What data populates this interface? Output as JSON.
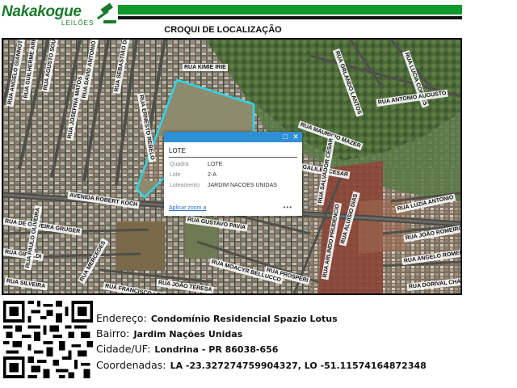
{
  "header": {
    "brand_name": "Nakakogue",
    "brand_sub": "LEILÕES",
    "title": "CROQUI DE LOCALIZAÇÃO"
  },
  "colors": {
    "brand_green": "#0e9a2c",
    "parcel_outline": "#2fd4e8",
    "popup_header": "#2f8fd3",
    "link_blue": "#2a6fc2"
  },
  "map": {
    "street_labels": [
      "RUA ANGELO GIANNOTTI",
      "RUA GUILHERME ARBELLI",
      "RUA AGUSTO SOUZA",
      "RUA JOSEFINA MATOS",
      "RUA DAVID ANTONIO PEDRO",
      "RUA SEBASTIÃO DE MELLO",
      "RUA ERNESTO REBELO",
      "RUA KIMIE IRIE",
      "RUA ORLANDO LANTOS",
      "RUA LUCIA CORTES",
      "RUA ANTONIO AUGUSTO",
      "RUA MAURÍCIO MAZER",
      "RUA GALILEU CESAR",
      "RUA SALVADOR CESAR",
      "AVENIDA ROBERT KOCH",
      "RUA GUSTAVO PAVIA",
      "RUA ARLINDO PRUDENCIO",
      "RUA DE OLIVEIRA GRUGER",
      "RUA GIRALDI",
      "RUA SILVEIRA",
      "RUA JOÃO TERESA",
      "RUA PAULO OLIVEIRA",
      "RUA MERCEDES",
      "RUA MOACYR BELLUCCO",
      "RUA PROSPERI",
      "RUA ALUÍSIO DIAS",
      "RUA LUZIA ANTONIO",
      "RUA JOÃO ROMEIRO",
      "RUA ANGELO ROMEIRO",
      "RUA DORIVAL CHAVES",
      "RUA FRANCISCO LEITE"
    ]
  },
  "popup": {
    "title": "LOTE",
    "rows": [
      {
        "key": "Quadra",
        "value": "LOTE"
      },
      {
        "key": "Lote",
        "value": "2-A"
      },
      {
        "key": "Loteamento",
        "value": "JARDIM NACOES UNIDAS"
      }
    ],
    "zoom_link": "Aplicar zoom a",
    "more": "•••",
    "maximize_icon": "□",
    "close_icon": "✕"
  },
  "info": {
    "endereco_label": "Endereço:",
    "endereco_value": "Condomínio Residencial Spazio Lotus",
    "bairro_label": "Bairro:",
    "bairro_value": "Jardim Nações Unidas",
    "cidade_label": "Cidade/UF:",
    "cidade_value": "Londrina - PR 86038-656",
    "coord_label": "Coordenadas:",
    "coord_value": "LA -23.327274759904327, LO -51.11574164872348"
  }
}
